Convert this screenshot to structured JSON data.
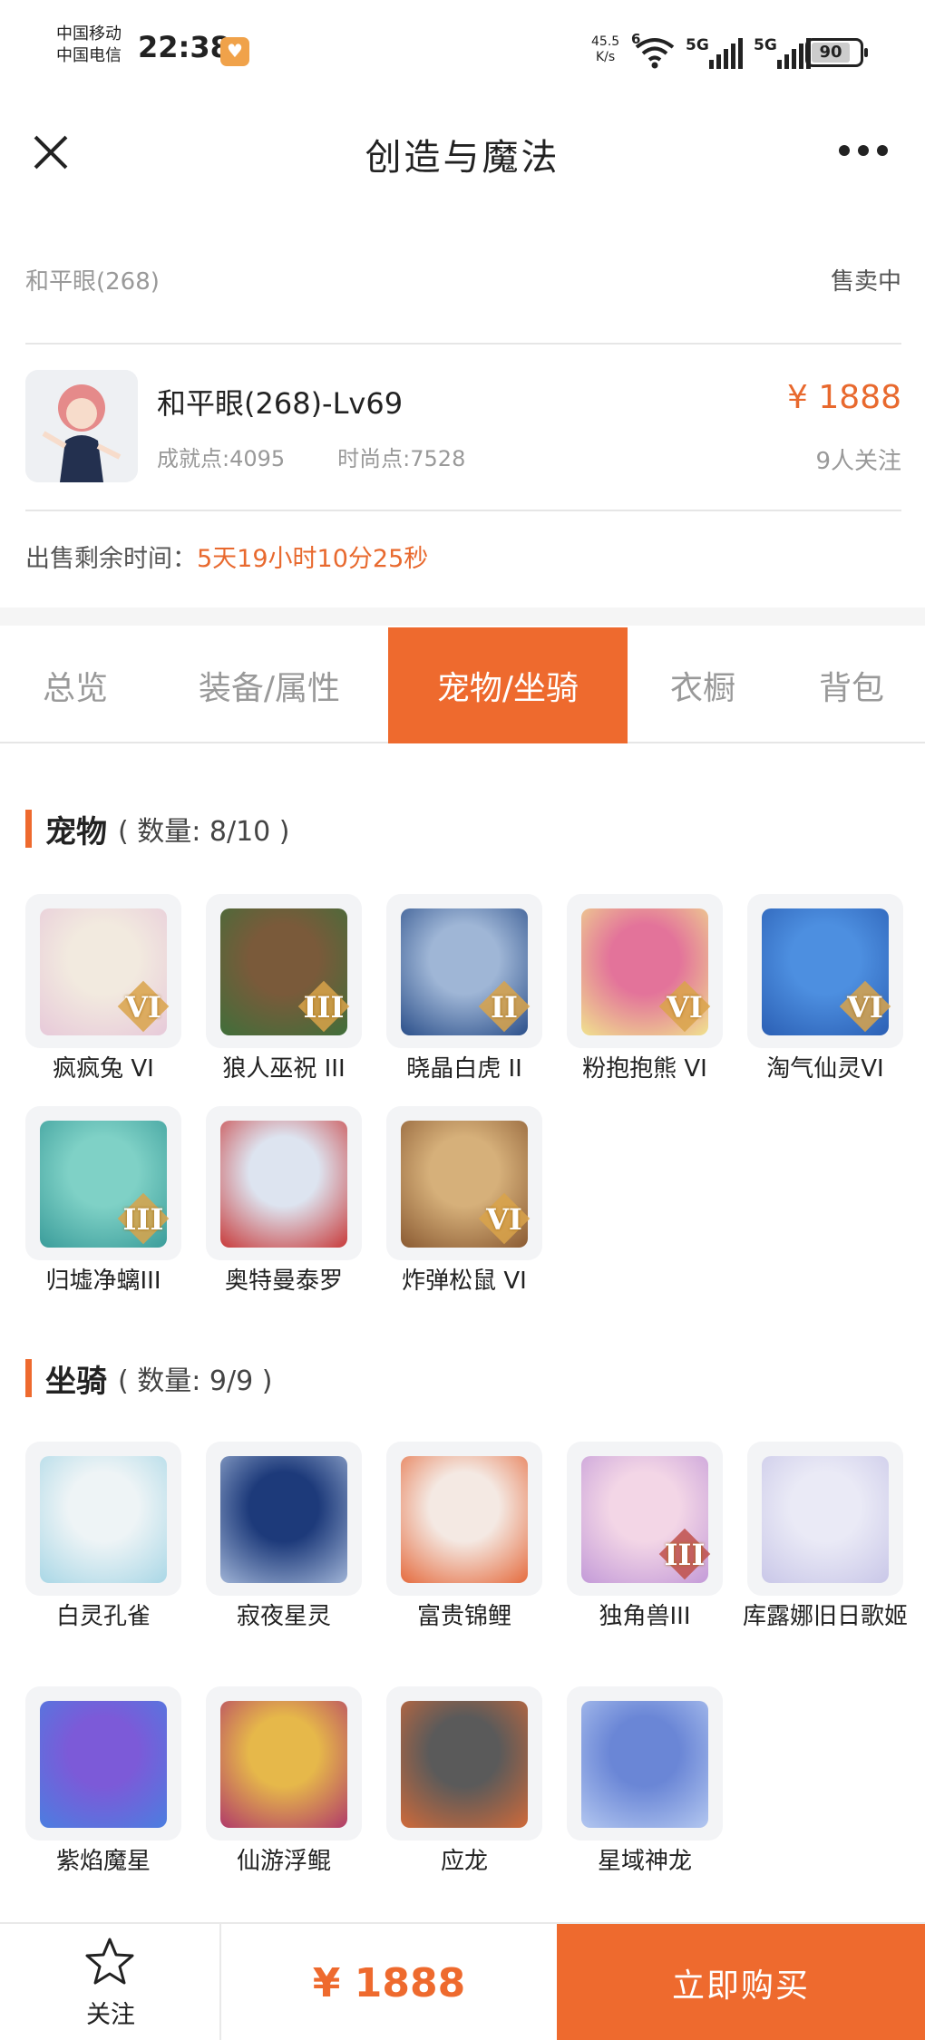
{
  "status_bar": {
    "carrier_1": "中国移动",
    "carrier_2": "中国电信",
    "time": "22:38",
    "net_speed": "45.5",
    "net_unit": "K/s",
    "wifi_tag": "6",
    "sig1_tag": "5G",
    "sig2_tag": "5G",
    "battery": "90"
  },
  "header": {
    "title": "创造与魔法"
  },
  "account": {
    "name": "和平眼(268)",
    "status": "售卖中",
    "item_title": "和平眼(268)-Lv69",
    "achievement": "成就点:4095",
    "fashion": "时尚点:7528",
    "price": "¥ 1888",
    "follows": "9人关注",
    "remaining_label": "出售剩余时间：",
    "remaining_value": "5天19小时10分25秒"
  },
  "tabs": [
    {
      "label": "总览",
      "active": false
    },
    {
      "label": "装备/属性",
      "active": false
    },
    {
      "label": "宠物/坐骑",
      "active": true
    },
    {
      "label": "衣橱",
      "active": false
    },
    {
      "label": "背包",
      "active": false
    }
  ],
  "pets": {
    "title": "宠物",
    "count": "( 数量: 8/10 )",
    "items": [
      {
        "label": "疯疯兔 VI",
        "tier": "VI",
        "c1": "#f2eadf",
        "c2": "#e7c9d9"
      },
      {
        "label": "狼人巫祝 III",
        "tier": "III",
        "c1": "#7a5a3a",
        "c2": "#3f6f3a"
      },
      {
        "label": "晓晶白虎 II",
        "tier": "II",
        "c1": "#9fb6d6",
        "c2": "#2b4f8a"
      },
      {
        "label": "粉抱抱熊 VI",
        "tier": "VI",
        "c1": "#e3739a",
        "c2": "#f0e28e"
      },
      {
        "label": "淘气仙灵VI",
        "tier": "VI",
        "c1": "#4d8fe0",
        "c2": "#2b5fb4"
      },
      {
        "label": "归墟净螭III",
        "tier": "III",
        "c1": "#7fd1c6",
        "c2": "#3a9c9a"
      },
      {
        "label": "奥特曼泰罗",
        "tier": "",
        "c1": "#dde4f0",
        "c2": "#c83a3a"
      },
      {
        "label": "炸弹松鼠 VI",
        "tier": "VI",
        "c1": "#d6b07a",
        "c2": "#8a5a32"
      }
    ]
  },
  "mounts": {
    "title": "坐骑",
    "count": "( 数量: 9/9 )",
    "items": [
      {
        "label": "白灵孔雀",
        "tier": "",
        "c1": "#eef4f6",
        "c2": "#a9d7e6"
      },
      {
        "label": "寂夜星灵",
        "tier": "",
        "c1": "#1d3a7a",
        "c2": "#9fb3d6"
      },
      {
        "label": "富贵锦鲤",
        "tier": "",
        "c1": "#f4e9e3",
        "c2": "#e56b3e"
      },
      {
        "label": "独角兽III",
        "tier": "III",
        "c1": "#f3d6e6",
        "c2": "#c39ad8"
      },
      {
        "label": "库露娜旧日歌姬",
        "tier": "",
        "c1": "#eaeaf6",
        "c2": "#c9c7e8"
      },
      {
        "label": "紫焰魔星",
        "tier": "",
        "c1": "#7c5ad8",
        "c2": "#4b7ee0"
      },
      {
        "label": "仙游浮鲲",
        "tier": "",
        "c1": "#e6b84a",
        "c2": "#b03a6a"
      },
      {
        "label": "应龙",
        "tier": "",
        "c1": "#5a5a5a",
        "c2": "#d06a3a"
      },
      {
        "label": "星域神龙",
        "tier": "",
        "c1": "#6a86d6",
        "c2": "#b3c7f0"
      }
    ]
  },
  "bottom": {
    "follow_label": "关注",
    "price": "¥ 1888",
    "buy_label": "立即购买"
  },
  "colors": {
    "accent": "#ee6a2e"
  }
}
